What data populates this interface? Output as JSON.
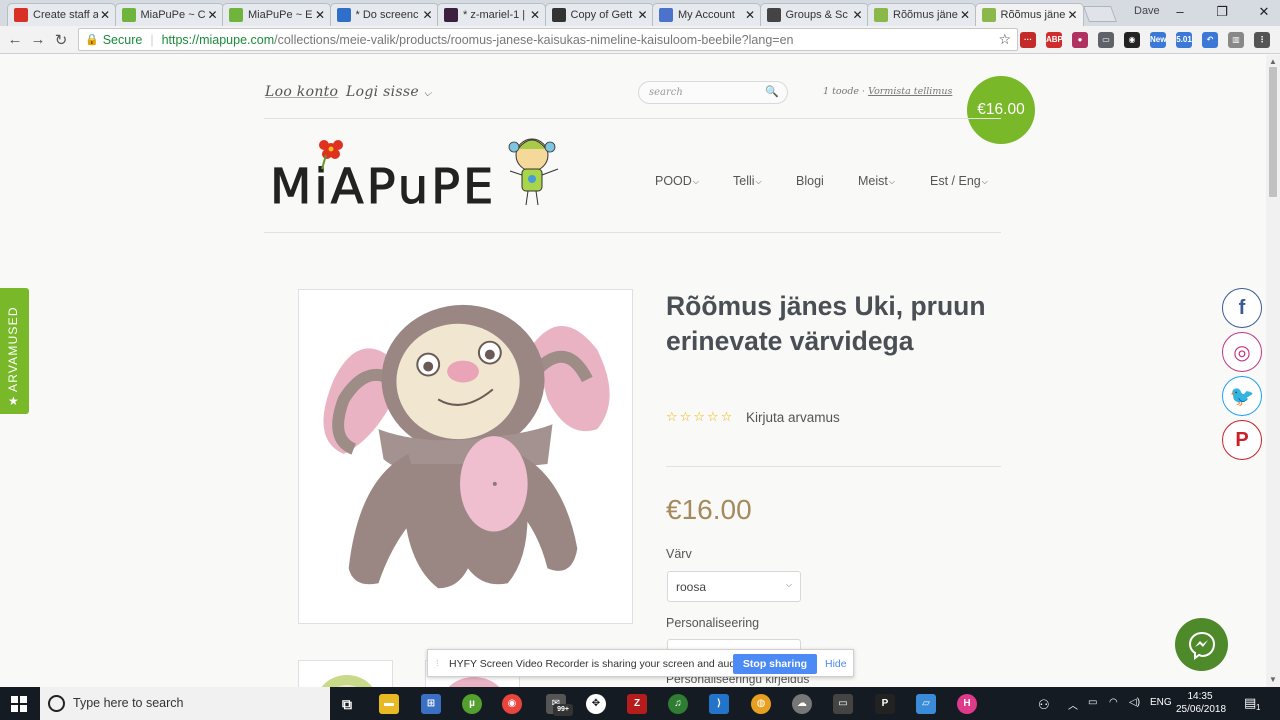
{
  "browser": {
    "tabs": [
      {
        "label": "Create staff a",
        "favicon_color": "#d93025",
        "active": false
      },
      {
        "label": "MiaPuPe ~ C",
        "favicon_color": "#6fb53d",
        "active": false
      },
      {
        "label": "MiaPuPe ~ E",
        "favicon_color": "#6fb53d",
        "active": false
      },
      {
        "label": "* Do screenc",
        "favicon_color": "#2f6fc9",
        "active": false
      },
      {
        "label": "* z-mariel-1 |",
        "favicon_color": "#3d1f3f",
        "active": false
      },
      {
        "label": "Copy of Gett",
        "favicon_color": "#333333",
        "active": false
      },
      {
        "label": "My Account",
        "favicon_color": "#4a73c9",
        "active": false
      },
      {
        "label": "Groups & Sc",
        "favicon_color": "#444444",
        "active": false
      },
      {
        "label": "Rõõmus jäne",
        "favicon_color": "#8ab84a",
        "active": false
      },
      {
        "label": "Rõõmus jäne",
        "favicon_color": "#8ab84a",
        "active": true
      }
    ],
    "user_label": "Dave",
    "secure_label": "Secure",
    "url_host": "https://miapupe.com",
    "url_path": "/collections/meie-valik/products/roomus-janese-kaisukas-nimeline-kaisuloom-beebile?lang=en",
    "extensions": [
      {
        "name": "extension-red-icon",
        "color": "#c52a2a",
        "text": "···"
      },
      {
        "name": "adblock-icon",
        "color": "#d12c2c",
        "text": "ABP"
      },
      {
        "name": "extension-record-icon",
        "color": "#b03060",
        "text": "●"
      },
      {
        "name": "cast-icon",
        "color": "#5f6368",
        "text": "▭"
      },
      {
        "name": "eye-icon",
        "color": "#222222",
        "text": "◉"
      },
      {
        "name": "new-extension-icon",
        "color": "#3b78d8",
        "text": "New"
      },
      {
        "name": "version-extension-icon",
        "color": "#3b78d8",
        "text": "5.01"
      },
      {
        "name": "undo-icon",
        "color": "#3b78d8",
        "text": "↶"
      },
      {
        "name": "panel-icon",
        "color": "#888888",
        "text": "▥"
      },
      {
        "name": "menu-icon",
        "color": "#555555",
        "text": "⋮"
      }
    ]
  },
  "site": {
    "create_account": "Loo konto",
    "login": "Logi sisse",
    "search_placeholder": "search",
    "cart_count": "1 toode",
    "cart_sep": " · ",
    "cart_checkout": "Vormista tellimus",
    "cart_total": "€16.00",
    "logo_text": "MiAPuPE",
    "nav": [
      {
        "label": "POOD",
        "dropdown": true
      },
      {
        "label": "Telli",
        "dropdown": true
      },
      {
        "label": "Blogi",
        "dropdown": false
      },
      {
        "label": "Meist",
        "dropdown": true
      },
      {
        "label": "Est / Eng",
        "dropdown": true
      }
    ],
    "reviews_tab": "ARVAMUSED"
  },
  "product": {
    "title": "Rõõmus jänes Uki, pruun erinevate värvidega",
    "rating_stars": 0,
    "rating_max": 5,
    "review_link": "Kirjuta arvamus",
    "price": "€16.00",
    "color_label": "Värv",
    "color_value": "roosa",
    "personalization_label": "Personaliseering",
    "personalization_text_label": "Personaliseeringu kirjeldus"
  },
  "social": [
    {
      "name": "facebook-icon",
      "glyph": "f",
      "color": "#3b5998"
    },
    {
      "name": "instagram-icon",
      "glyph": "◎",
      "color": "#c13584"
    },
    {
      "name": "twitter-icon",
      "glyph": "🐦",
      "color": "#1da1f2"
    },
    {
      "name": "pinterest-icon",
      "glyph": "P",
      "color": "#cb2027"
    }
  ],
  "share_bar": {
    "message": "HYFY Screen Video Recorder is sharing your screen and audio.",
    "stop_label": "Stop sharing",
    "hide_label": "Hide"
  },
  "taskbar": {
    "search_placeholder": "Type here to search",
    "badge_count": "99+",
    "language": "ENG",
    "time": "14:35",
    "date": "25/06/2018",
    "notification_count": "1"
  },
  "colors": {
    "brand_green": "#79b829",
    "price_gold": "#a58a5e",
    "share_blue": "#4c8bf5"
  }
}
